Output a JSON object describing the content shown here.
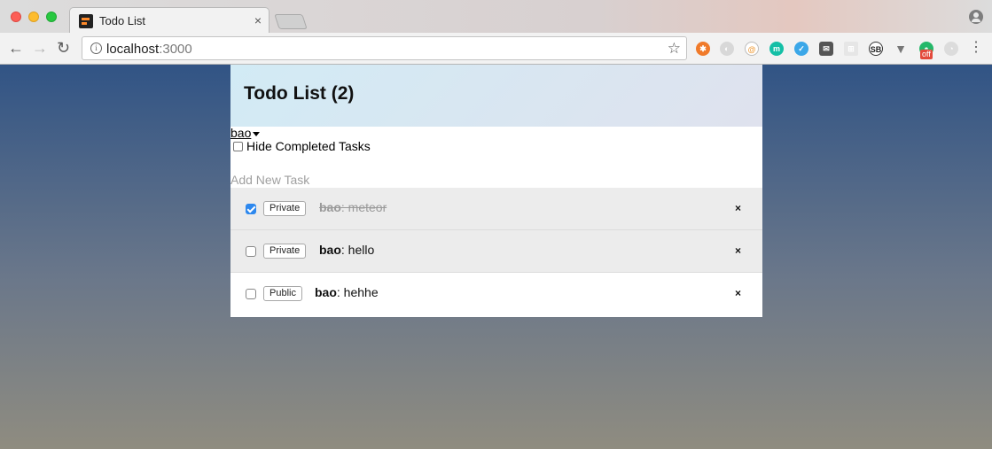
{
  "browser": {
    "tab_title": "Todo List",
    "tab_close": "×",
    "url_host": "localhost",
    "url_port": ":3000",
    "nav": {
      "back": "←",
      "forward": "→",
      "reload": "↻"
    },
    "info_glyph": "i",
    "star_glyph": "☆",
    "menu_glyph": "⋮",
    "extension_badge": "off",
    "extensions": [
      {
        "icon": "orange-lifebuoy-icon",
        "glyph": "✱"
      },
      {
        "icon": "grey-swirl-icon",
        "glyph": "◐"
      },
      {
        "icon": "at-sign-icon",
        "glyph": "@"
      },
      {
        "icon": "teal-m-icon",
        "glyph": "m"
      },
      {
        "icon": "blue-v-icon",
        "glyph": "✓"
      },
      {
        "icon": "envelope-icon",
        "glyph": "✉"
      },
      {
        "icon": "grid-icon",
        "glyph": "⊞"
      },
      {
        "icon": "sb-icon",
        "glyph": "SB"
      },
      {
        "icon": "vue-icon",
        "glyph": "▼"
      },
      {
        "icon": "green-off-icon",
        "glyph": "◓"
      },
      {
        "icon": "weibo-icon",
        "glyph": "◔"
      }
    ]
  },
  "app": {
    "title": "Todo List (2)",
    "user": "bao",
    "hide_completed_label": "Hide Completed Tasks",
    "new_task_placeholder": "Add New Task",
    "tasks": [
      {
        "owner": "bao",
        "text": ": meteor",
        "privacy": "Private",
        "checked": true
      },
      {
        "owner": "bao",
        "text": ": hello",
        "privacy": "Private",
        "checked": false
      },
      {
        "owner": "bao",
        "text": ": hehhe",
        "privacy": "Public",
        "checked": false
      }
    ],
    "delete_glyph": "×"
  }
}
